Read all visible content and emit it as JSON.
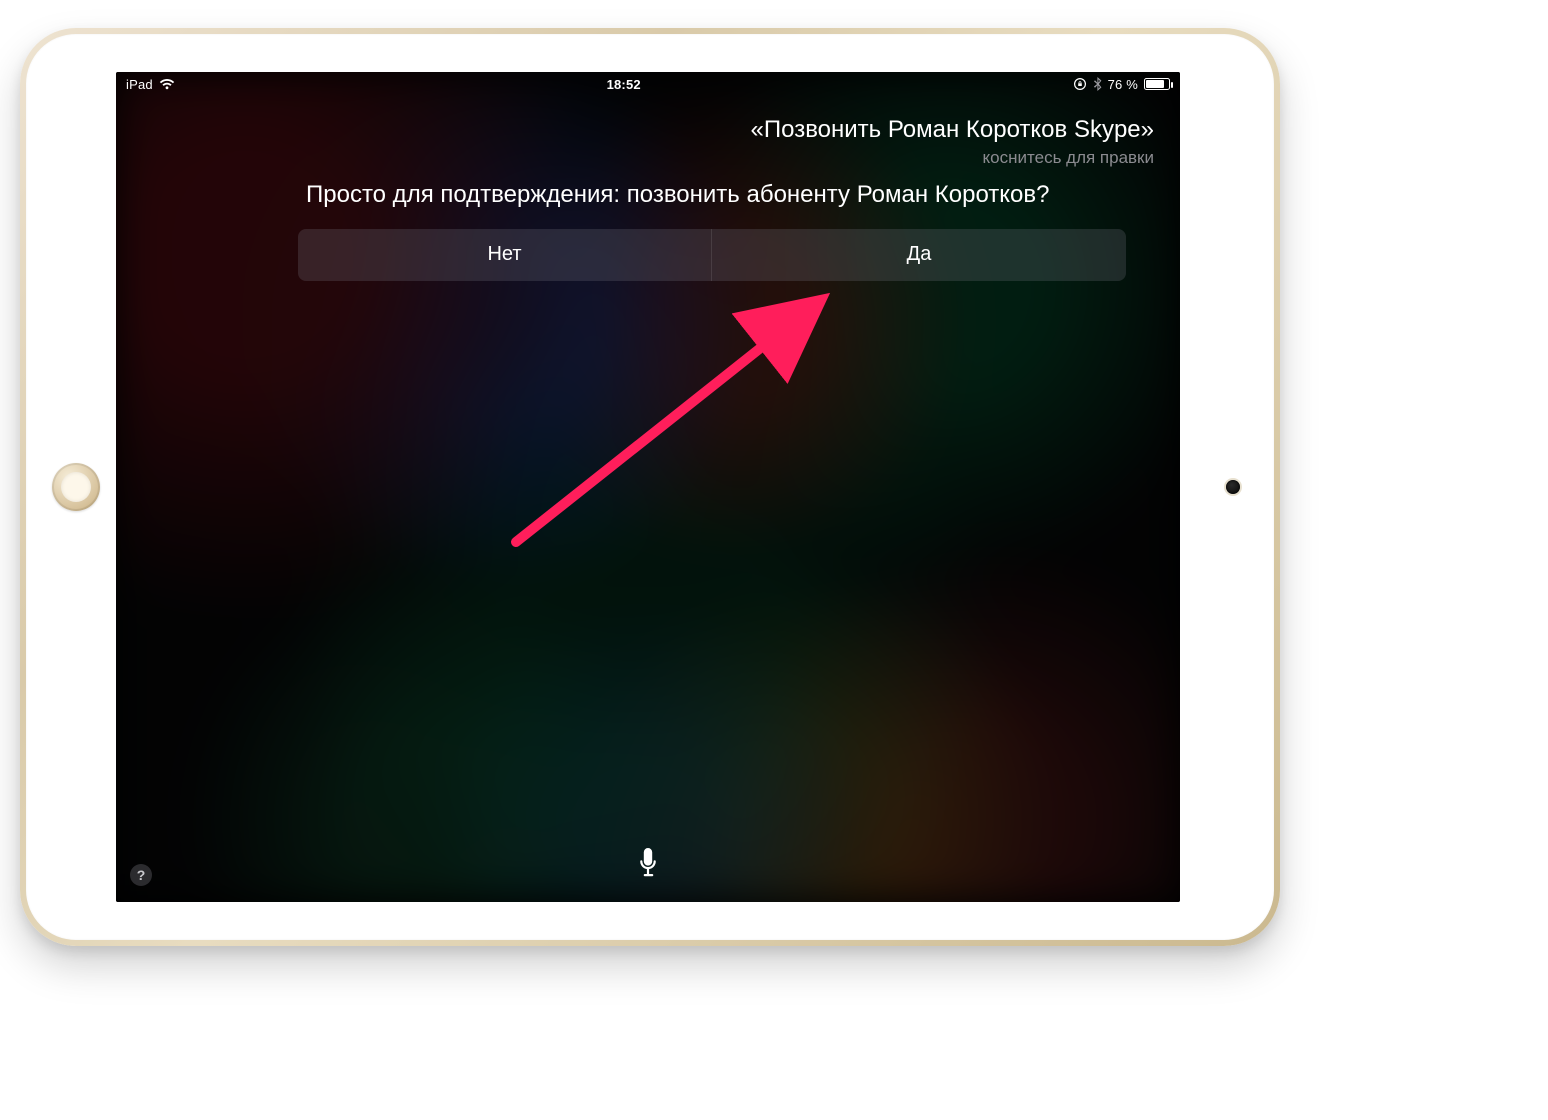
{
  "statusbar": {
    "device_label": "iPad",
    "time": "18:52",
    "battery_pct": "76 %"
  },
  "siri": {
    "user_query": "«Позвонить Роман Коротков Skype»",
    "edit_hint": "коснитесь для правки",
    "response": "Просто для подтверждения: позвонить абоненту Роман Коротков?",
    "no_label": "Нет",
    "yes_label": "Да",
    "help_glyph": "?"
  },
  "annotation": {
    "arrow_color": "#ff1e5b"
  }
}
